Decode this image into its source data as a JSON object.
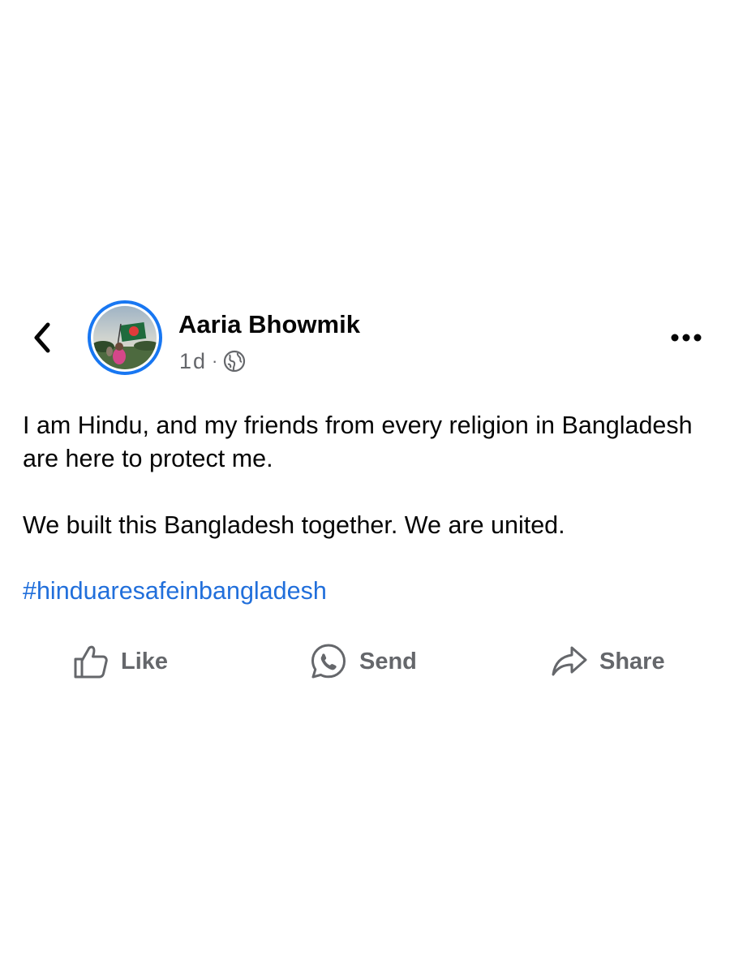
{
  "post": {
    "author": "Aaria Bhowmik",
    "time": "1d",
    "separator": "·",
    "audience_icon": "globe-icon",
    "paragraphs": [
      "I am Hindu, and my friends from every religion in Bangladesh are here to protect me.",
      "We built this Bangladesh together. We are united."
    ],
    "hashtag": "#hinduaresafeinbangladesh"
  },
  "actions": {
    "like": "Like",
    "send": "Send",
    "share": "Share"
  },
  "icons": {
    "back": "chevron-left-icon",
    "more": "more-horizontal-icon",
    "like": "thumbs-up-icon",
    "send": "whatsapp-icon",
    "share": "share-arrow-icon"
  },
  "colors": {
    "accent": "#1877f2",
    "hashtag": "#216fdb",
    "secondary_text": "#65676b"
  }
}
